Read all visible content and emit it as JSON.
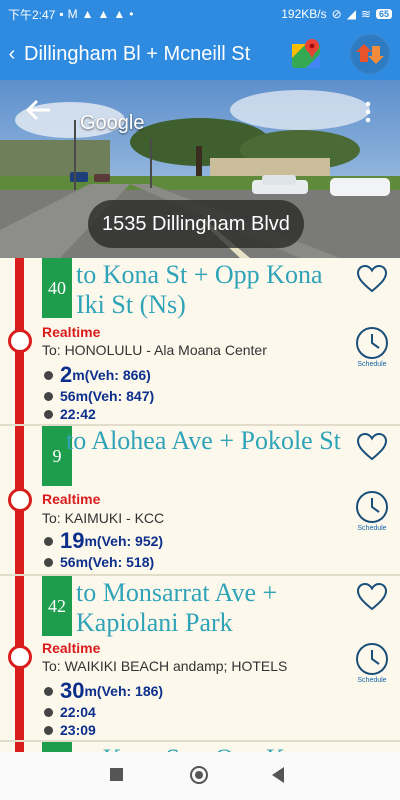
{
  "status_bar": {
    "time": "下午2:47",
    "network_speed": "192KB/s",
    "battery": "65"
  },
  "app_bar": {
    "title": "Dillingham Bl + Mcneill St"
  },
  "street_view": {
    "brand": "Google",
    "address": "1535 Dillingham Blvd"
  },
  "routes": [
    {
      "route": "40",
      "destination": "to Kona St + Opp Kona Iki St (Ns)",
      "status": "Realtime",
      "to": "To: HONOLULU - Ala Moana Center",
      "arrivals": [
        {
          "big": "2",
          "small": "m(Veh: 866)"
        },
        {
          "big": "",
          "small": "56m(Veh: 847)"
        },
        {
          "big": "",
          "small": "22:42"
        }
      ],
      "schedule_label": "Schedule"
    },
    {
      "route": "9",
      "destination": "to Alohea Ave + Pokole St",
      "status": "Realtime",
      "to": "To: KAIMUKI - KCC",
      "arrivals": [
        {
          "big": "19",
          "small": "m(Veh: 952)"
        },
        {
          "big": "",
          "small": "56m(Veh: 518)"
        }
      ],
      "schedule_label": "Schedule"
    },
    {
      "route": "42",
      "destination": "to Monsarrat Ave + Kapiolani Park",
      "status": "Realtime",
      "to": "To: WAIKIKI BEACH andamp; HOTELS",
      "arrivals": [
        {
          "big": "30",
          "small": "m(Veh: 186)"
        },
        {
          "big": "",
          "small": "22:04"
        },
        {
          "big": "",
          "small": "23:09"
        }
      ],
      "schedule_label": "Schedule"
    }
  ],
  "partial_next": {
    "destination": "to Kona St + Opp K"
  },
  "icons": {
    "back": "chevron-left-icon",
    "map": "google-maps-icon",
    "swap": "swap-direction-icon",
    "favorite": "heart-outline-icon",
    "schedule": "clock-icon",
    "more": "more-vert-icon"
  },
  "colors": {
    "app_bar": "#2f8be0",
    "route_badge": "#1e9e4d",
    "rail": "#d91c1c",
    "destination_text": "#2fa3b8",
    "arrival_text": "#0d2f8c",
    "list_background": "#fdf8ec"
  }
}
